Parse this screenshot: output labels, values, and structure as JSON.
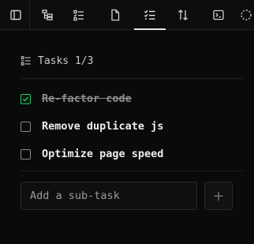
{
  "toolbar": {
    "icons": [
      "sidebar-toggle-icon",
      "tree-structure-icon",
      "list-checklist-icon",
      "file-icon",
      "tasks-icon",
      "sort-arrows-icon",
      "terminal-icon",
      "loading-icon"
    ],
    "active": "tasks-icon"
  },
  "tasks_panel": {
    "title": "Tasks 1/3",
    "items": [
      {
        "label": "Re-factor code",
        "done": true
      },
      {
        "label": "Remove duplicate js",
        "done": false
      },
      {
        "label": "Optimize page speed",
        "done": false
      }
    ],
    "subtask_placeholder": "Add a sub-task",
    "add_label": "+"
  },
  "colors": {
    "accent_check": "#22c55e",
    "background": "#0a0a0a"
  }
}
